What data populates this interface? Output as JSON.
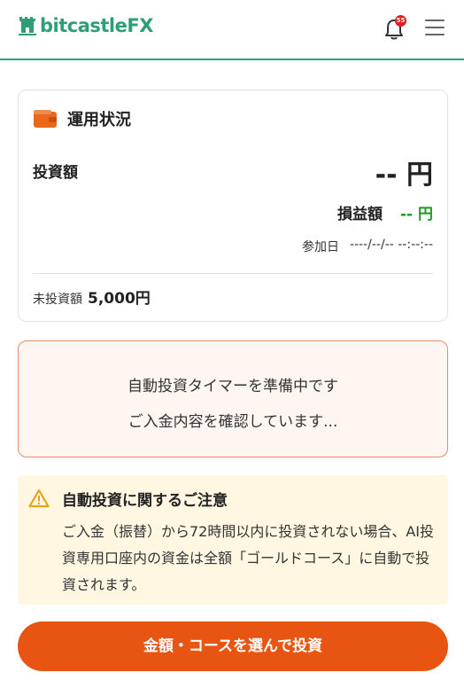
{
  "header": {
    "logo_text": "bitcastleFX",
    "notification_count": "55",
    "brand_color": "#2f9d78"
  },
  "status_card": {
    "title": "運用状況",
    "investment_label": "投資額",
    "investment_value": "-- 円",
    "pl_label": "損益額",
    "pl_value": "-- 円",
    "pl_color": "#1f9a1f",
    "join_label": "参加日",
    "join_value": "----/--/-- --:--:--",
    "uninvested_label": "未投資額",
    "uninvested_value": "5,000円",
    "icon": "wallet-icon"
  },
  "timer": {
    "line1": "自動投資タイマーを準備中です",
    "line2": "ご入金内容を確認しています..."
  },
  "notice": {
    "icon": "warning-icon",
    "title": "自動投資に関するご注意",
    "body": "ご入金（振替）から72時間以内に投資されない場合、AI投資専用口座内の資金は全額「ゴールドコース」に自動で投資されます。"
  },
  "cta": {
    "label": "金額・コースを選んで投資",
    "color": "#e85513"
  }
}
